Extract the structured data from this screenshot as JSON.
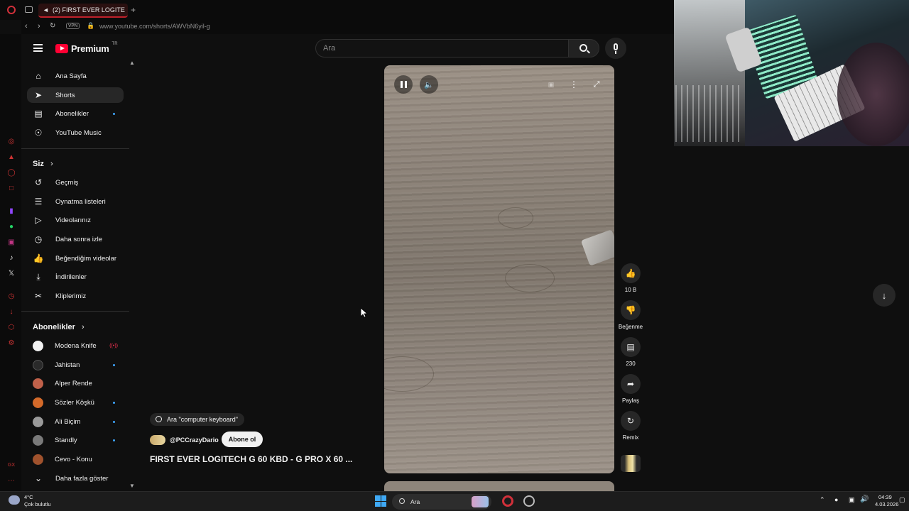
{
  "browser": {
    "tab_title": "(2) FIRST EVER LOGITE",
    "address": "www.youtube.com/shorts/AWVbN6yil-g",
    "vpn_label": "VPN"
  },
  "youtube": {
    "logo_text": "Premium",
    "country_code": "TR",
    "search_placeholder": "Ara"
  },
  "nav": {
    "main": [
      {
        "label": "Ana Sayfa",
        "icon": "home-icon"
      },
      {
        "label": "Shorts",
        "icon": "shorts-icon"
      },
      {
        "label": "Abonelikler",
        "icon": "subscriptions-icon"
      },
      {
        "label": "YouTube Music",
        "icon": "music-icon"
      }
    ],
    "you_title": "Siz",
    "you": [
      {
        "label": "Geçmiş",
        "icon": "history-icon"
      },
      {
        "label": "Oynatma listeleri",
        "icon": "playlists-icon"
      },
      {
        "label": "Videolarınız",
        "icon": "your-videos-icon"
      },
      {
        "label": "Daha sonra izle",
        "icon": "watch-later-icon"
      },
      {
        "label": "Beğendiğim videolar",
        "icon": "liked-icon"
      },
      {
        "label": "İndirilenler",
        "icon": "downloads-icon"
      },
      {
        "label": "Kliplerimiz",
        "icon": "clips-icon"
      }
    ],
    "subs_title": "Abonelikler",
    "subs": [
      {
        "label": "Modena Knife",
        "color": "#f1f1f1"
      },
      {
        "label": "Jahistan",
        "color": "#2a2a2a"
      },
      {
        "label": "Alper Rende",
        "color": "#c0614a"
      },
      {
        "label": "Sözler Köşkü",
        "color": "#d46a2a"
      },
      {
        "label": "Ali Biçim",
        "color": "#9a9a9a"
      },
      {
        "label": "Standly",
        "color": "#7a7a7a"
      },
      {
        "label": "Cevo - Konu",
        "color": "#a0522d"
      }
    ],
    "more_label": "Daha fazla göster"
  },
  "short": {
    "suggestion": "Ara \"computer keyboard\"",
    "channel": "@PCCrazyDario",
    "subscribe": "Abone ol",
    "title": "FIRST EVER LOGITECH G 60 KBD - G PRO X 60 ...",
    "like_count": "10 B",
    "dislike_label": "Beğenme",
    "comment_count": "230",
    "share_label": "Paylaş",
    "remix_label": "Remix"
  },
  "taskbar": {
    "temp": "4°C",
    "weather": "Çok bulutlu",
    "search": "Ara",
    "time": "04:39",
    "date": "4.03.2026"
  }
}
